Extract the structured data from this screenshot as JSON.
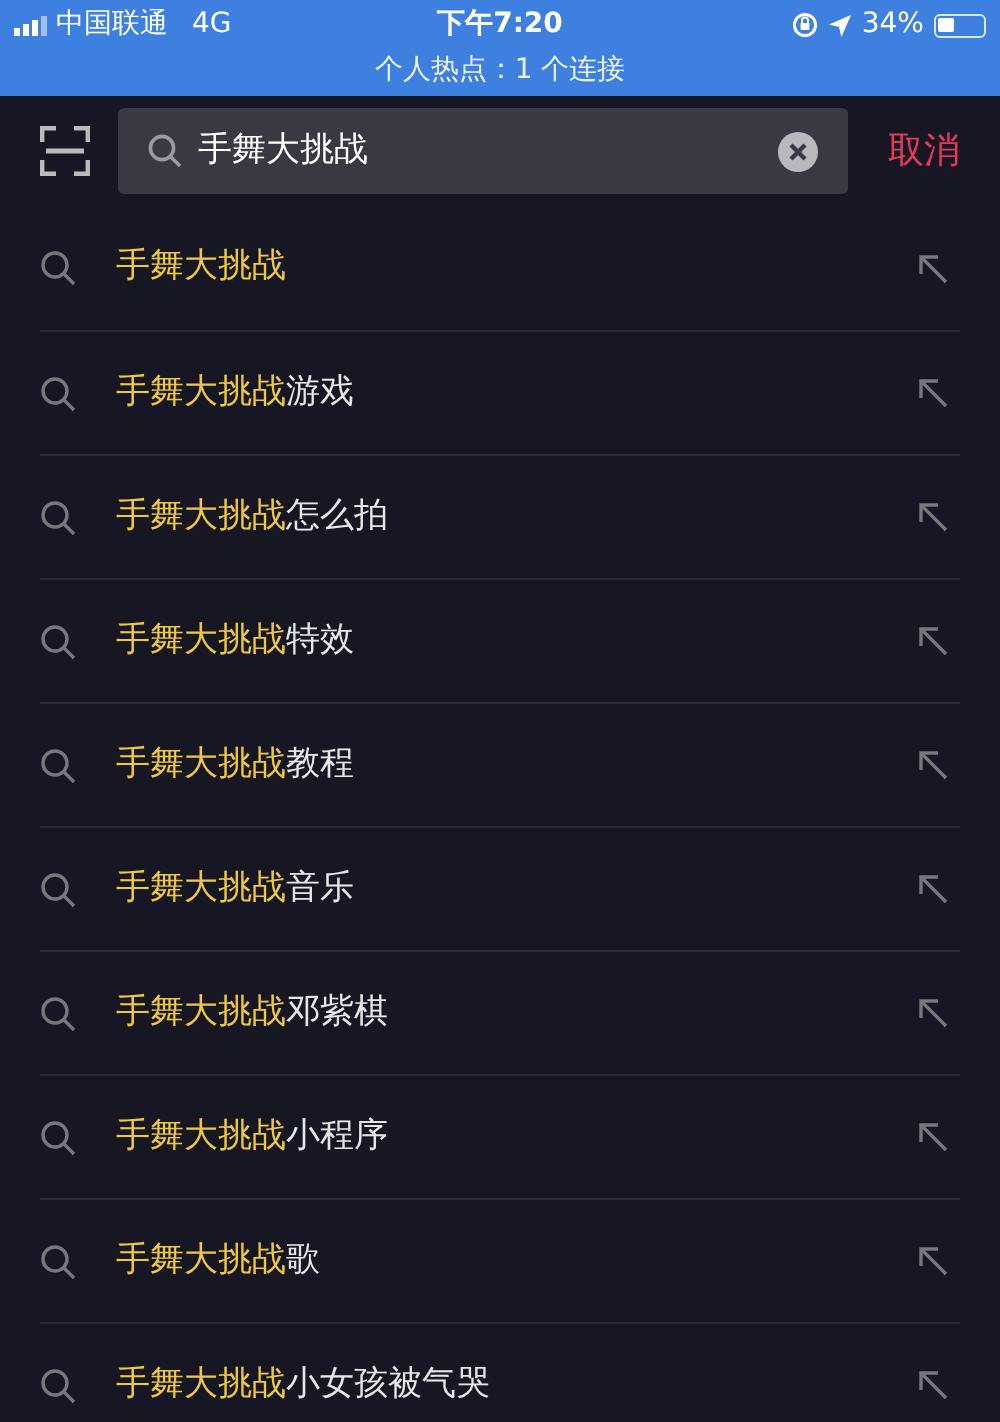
{
  "status_bar": {
    "carrier": "中国联通",
    "network": "4G",
    "time": "下午7:20",
    "battery": "34%",
    "hotspot": "个人热点：1 个连接"
  },
  "search": {
    "value": "手舞大挑战",
    "cancel": "取消"
  },
  "suggestions": [
    {
      "match": "手舞大挑战"
    },
    {
      "match": "手舞大挑战",
      "rest": "游戏"
    },
    {
      "match": "手舞大挑战",
      "rest": "怎么拍"
    },
    {
      "match": "手舞大挑战",
      "rest": "特效"
    },
    {
      "match": "手舞大挑战",
      "rest": "教程"
    },
    {
      "match": "手舞大挑战",
      "rest": "音乐"
    },
    {
      "match": "手舞大挑战",
      "rest": "邓紫棋"
    },
    {
      "match": "手舞大挑战",
      "rest": "小程序"
    },
    {
      "match": "手舞大挑战",
      "rest": "歌"
    },
    {
      "match": "手舞大挑战",
      "rest": "小女孩被气哭"
    }
  ]
}
